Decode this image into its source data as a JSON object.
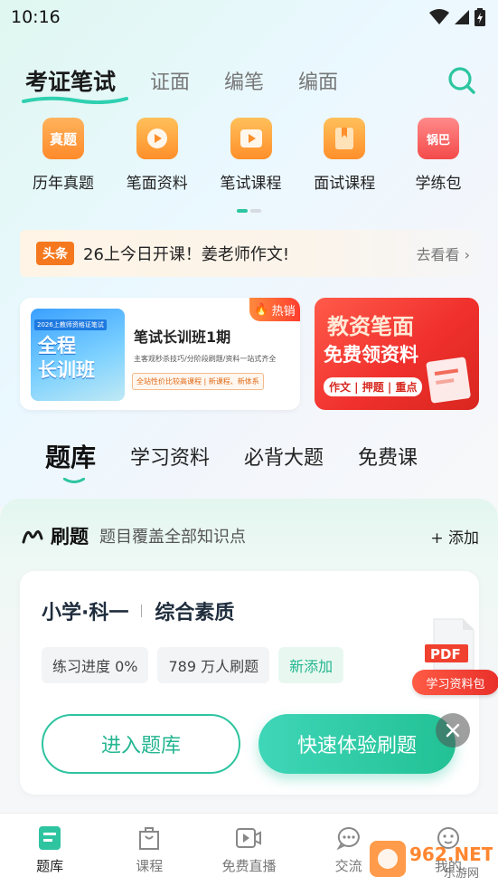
{
  "status": {
    "time": "10:16"
  },
  "top_nav": {
    "tabs": [
      "考证笔试",
      "证面",
      "编笔",
      "编面"
    ],
    "active_index": 0
  },
  "categories": [
    {
      "label": "历年真题",
      "icon": "real-exam-icon",
      "icon_text": "真题"
    },
    {
      "label": "笔面资料",
      "icon": "play-folder-icon"
    },
    {
      "label": "笔试课程",
      "icon": "play-video-icon"
    },
    {
      "label": "面试课程",
      "icon": "bookmark-book-icon"
    },
    {
      "label": "学练包",
      "icon": "learning-pack-icon",
      "icon_text": "锅巴"
    }
  ],
  "headline": {
    "badge": "头条",
    "text": "26上今日开课！姜老师作文!",
    "more": "去看看 ›"
  },
  "banner_left": {
    "hot_tag": "热销",
    "thumb_top": "2026上教师资格证笔试",
    "thumb_line1": "全程",
    "thumb_line2": "长训班",
    "title": "笔试长训班1期",
    "subtitle": "主客观秒杀技巧/分阶段刷题/资料一站式齐全",
    "tags": "全站性价比较高课程 | 新课程、新体系"
  },
  "banner_right": {
    "line1": "教资笔面",
    "line2": "免费领资料",
    "pill": "作文 | 押题 | 重点"
  },
  "content_tabs": {
    "items": [
      "题库",
      "学习资料",
      "必背大题",
      "免费课"
    ],
    "active_index": 0
  },
  "question_bank": {
    "title": "刷题",
    "desc": "题目覆盖全部知识点",
    "add": "+ 添加",
    "card": {
      "subject_a": "小学·科一",
      "subject_b": "综合素质",
      "progress": "练习进度 0%",
      "users": "789 万人刷题",
      "new_tag": "新添加",
      "enter_button": "进入题库",
      "quick_button": "快速体验刷题"
    }
  },
  "float_ad": {
    "pdf_text": "PDF",
    "label": "学习资料包"
  },
  "bottom_nav": {
    "items": [
      "题库",
      "课程",
      "免费直播",
      "交流",
      "我的"
    ],
    "active_index": 0
  },
  "watermark": {
    "main": "962.NET",
    "sub": "乐游网"
  },
  "colors": {
    "accent": "#2ec4a0",
    "orange": "#f5781e",
    "red": "#e8302a"
  }
}
